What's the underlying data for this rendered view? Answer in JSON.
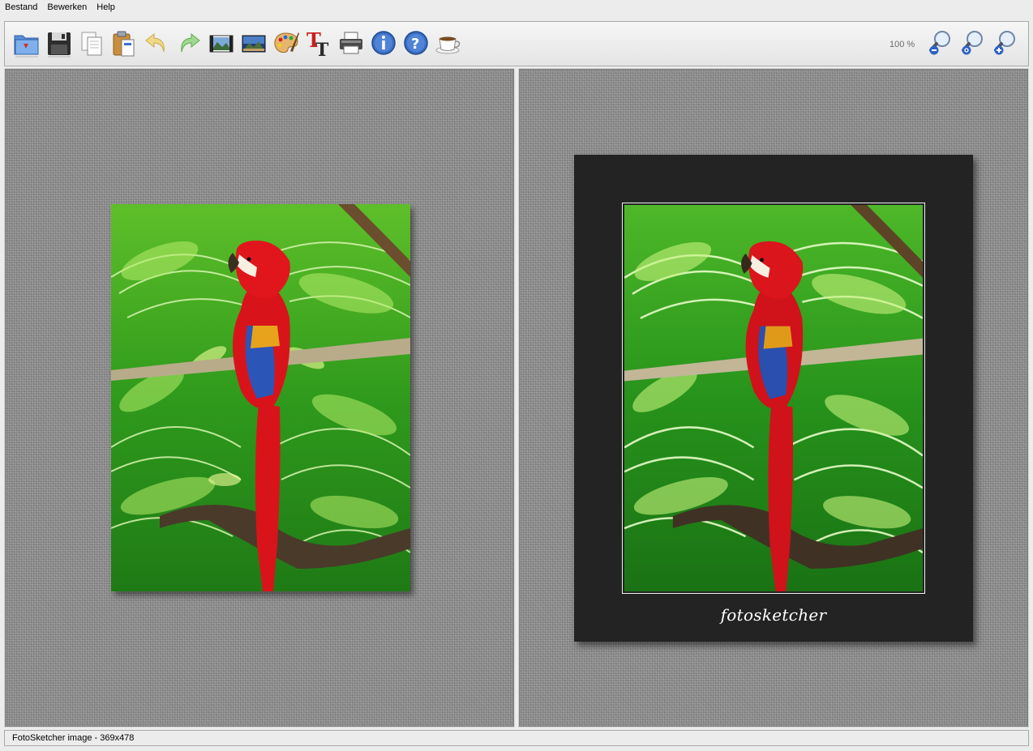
{
  "menu": {
    "items": [
      "Bestand",
      "Bewerken",
      "Help"
    ]
  },
  "toolbar": {
    "buttons": [
      {
        "name": "open-icon"
      },
      {
        "name": "save-icon"
      },
      {
        "name": "copy-icon"
      },
      {
        "name": "paste-icon"
      },
      {
        "name": "undo-icon"
      },
      {
        "name": "redo-icon"
      },
      {
        "name": "original-image-icon"
      },
      {
        "name": "landscape-image-icon"
      },
      {
        "name": "palette-icon"
      },
      {
        "name": "text-icon"
      },
      {
        "name": "print-icon"
      },
      {
        "name": "info-icon"
      },
      {
        "name": "help-icon"
      },
      {
        "name": "coffee-icon"
      }
    ],
    "zoom_level": "100 %",
    "zoom_buttons": [
      {
        "name": "zoom-out-icon"
      },
      {
        "name": "zoom-reset-icon"
      },
      {
        "name": "zoom-in-icon"
      }
    ]
  },
  "preview": {
    "caption": "fotosketcher"
  },
  "status": {
    "text": "FotoSketcher image - 369x478"
  },
  "colors": {
    "mat": "#232323",
    "parrot_red": "#d8141a",
    "parrot_blue": "#2c55b8",
    "foliage": "#2f9a1c"
  }
}
